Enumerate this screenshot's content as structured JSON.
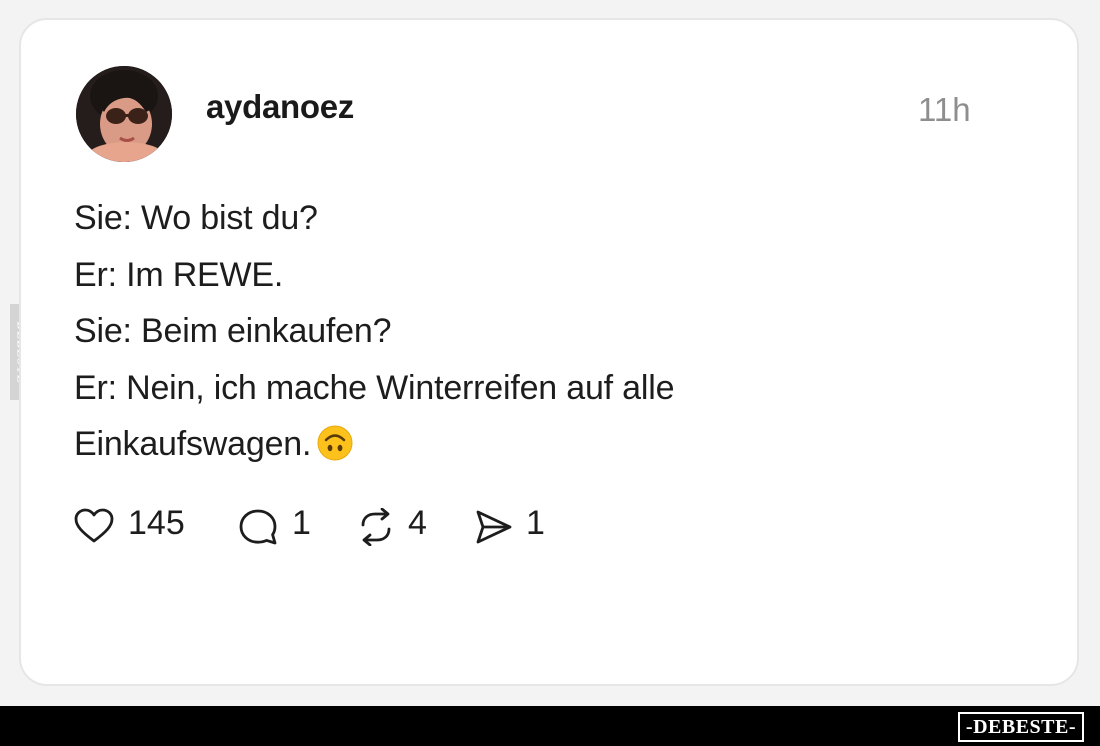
{
  "post": {
    "username": "aydanoez",
    "timestamp": "11h",
    "lines": [
      "Sie: Wo bist du?",
      "Er: Im REWE.",
      "Sie: Beim einkaufen?",
      "Er: Nein, ich mache Winterreifen auf alle",
      "Einkaufswagen."
    ],
    "emoji": "upside-down-face"
  },
  "actions": {
    "likes": "145",
    "replies": "1",
    "reposts": "4",
    "shares": "1"
  },
  "watermark": {
    "side_text": "DEBESTE",
    "footer_text": "-DEBESTE-"
  },
  "colors": {
    "background": "#f3f3f3",
    "card": "#ffffff",
    "text": "#1d1d1d",
    "muted": "#8e8e8e",
    "footer": "#000000"
  }
}
